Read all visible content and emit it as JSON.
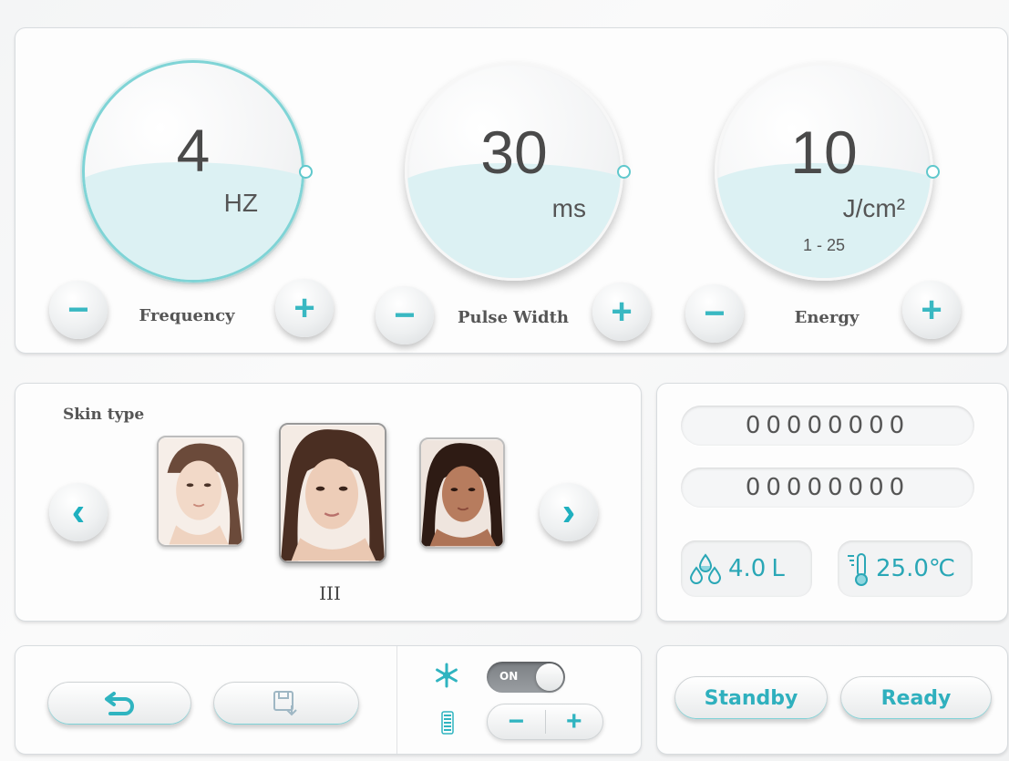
{
  "params": [
    {
      "label": "Frequency",
      "value": "4",
      "unit": "HZ",
      "range": ""
    },
    {
      "label": "Pulse Width",
      "value": "30",
      "unit": "ms",
      "range": ""
    },
    {
      "label": "Energy",
      "value": "10",
      "unit": "J/cm²",
      "range": "1 - 25"
    }
  ],
  "buttons": {
    "minus": "−",
    "plus": "+"
  },
  "skin": {
    "title": "Skin type",
    "selected_value": "III",
    "prev_icon": "‹",
    "next_icon": "›"
  },
  "counters": [
    "00000000",
    "00000000"
  ],
  "water": {
    "value": "4.0",
    "unit": "L"
  },
  "temperature": {
    "value": "25.0℃"
  },
  "cooling": {
    "toggle_label": "ON"
  },
  "stepper": {
    "minus": "−",
    "plus": "+"
  },
  "actions": {
    "standby": "Standby",
    "ready": "Ready"
  },
  "colors": {
    "accent": "#2fb4c0",
    "wave": "#dcf1f3",
    "active_ring": "#7fd4d6"
  }
}
